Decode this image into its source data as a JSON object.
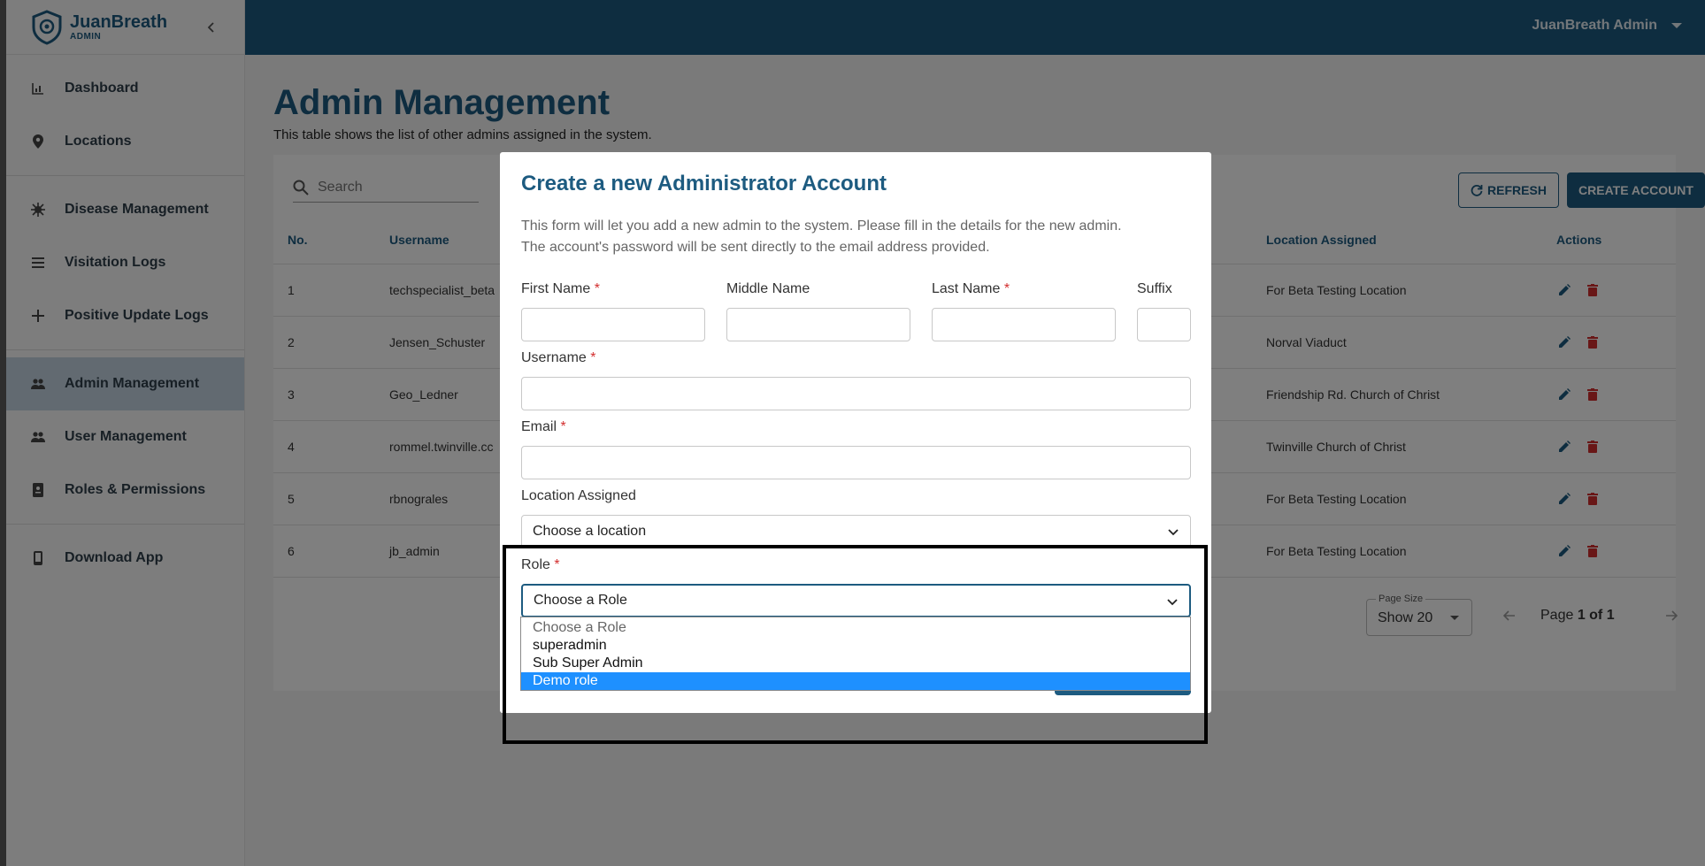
{
  "app": {
    "brand_name": "JuanBreath",
    "brand_sub": "ADMIN",
    "user_menu_label": "JuanBreath Admin",
    "accent_color": "#1d5b80",
    "danger_color": "#d32f2f"
  },
  "sidebar": {
    "items": [
      {
        "label": "Dashboard",
        "icon": "bar-chart-icon"
      },
      {
        "label": "Locations",
        "icon": "map-pin-icon"
      },
      {
        "label": "Disease Management",
        "icon": "virus-icon"
      },
      {
        "label": "Visitation Logs",
        "icon": "list-icon"
      },
      {
        "label": "Positive Update Logs",
        "icon": "plus-icon"
      },
      {
        "label": "Admin Management",
        "icon": "people-icon",
        "active": true
      },
      {
        "label": "User Management",
        "icon": "people-icon"
      },
      {
        "label": "Roles & Permissions",
        "icon": "badge-icon"
      },
      {
        "label": "Download App",
        "icon": "phone-icon"
      }
    ]
  },
  "main": {
    "title": "Admin Management",
    "description": "This table shows the list of other admins assigned in the system.",
    "search_placeholder": "Search",
    "refresh_label": "REFRESH",
    "create_label": "CREATE ACCOUNT",
    "table": {
      "headers": {
        "no": "No.",
        "username": "Username",
        "location": "Location Assigned",
        "actions": "Actions"
      },
      "rows": [
        {
          "no": "1",
          "username": "techspecialist_beta",
          "location": "For Beta Testing Location"
        },
        {
          "no": "2",
          "username": "Jensen_Schuster",
          "location": "Norval Viaduct"
        },
        {
          "no": "3",
          "username": "Geo_Ledner",
          "location": "Friendship Rd. Church of Christ"
        },
        {
          "no": "4",
          "username": "rommel.twinville.cc",
          "location": "Twinville Church of Christ"
        },
        {
          "no": "5",
          "username": "rbnograles",
          "location": "For Beta Testing Location"
        },
        {
          "no": "6",
          "username": "jb_admin",
          "location": "For Beta Testing Location"
        }
      ]
    },
    "pager": {
      "page_size_label": "Page Size",
      "page_size_value": "Show 20",
      "page_prefix": "Page ",
      "page_value": "1 of 1"
    }
  },
  "modal": {
    "title": "Create a new Administrator Account",
    "desc_line1": "This form will let you add a new admin to the system. Please fill in the details for the new admin.",
    "desc_line2": "The account's password will be sent directly to the email address provided.",
    "first_name_label": "First Name",
    "middle_name_label": "Middle Name",
    "last_name_label": "Last Name",
    "suffix_label": "Suffix",
    "username_label": "Username",
    "email_label": "Email",
    "location_label": "Location Assigned",
    "location_value": "Choose a location",
    "role_label": "Role",
    "role_value": "Choose a Role",
    "required_mark": "*",
    "role_options": [
      "Choose a Role",
      "superadmin",
      "Sub Super Admin",
      "Demo role"
    ],
    "role_highlighted_option": "Demo role"
  }
}
